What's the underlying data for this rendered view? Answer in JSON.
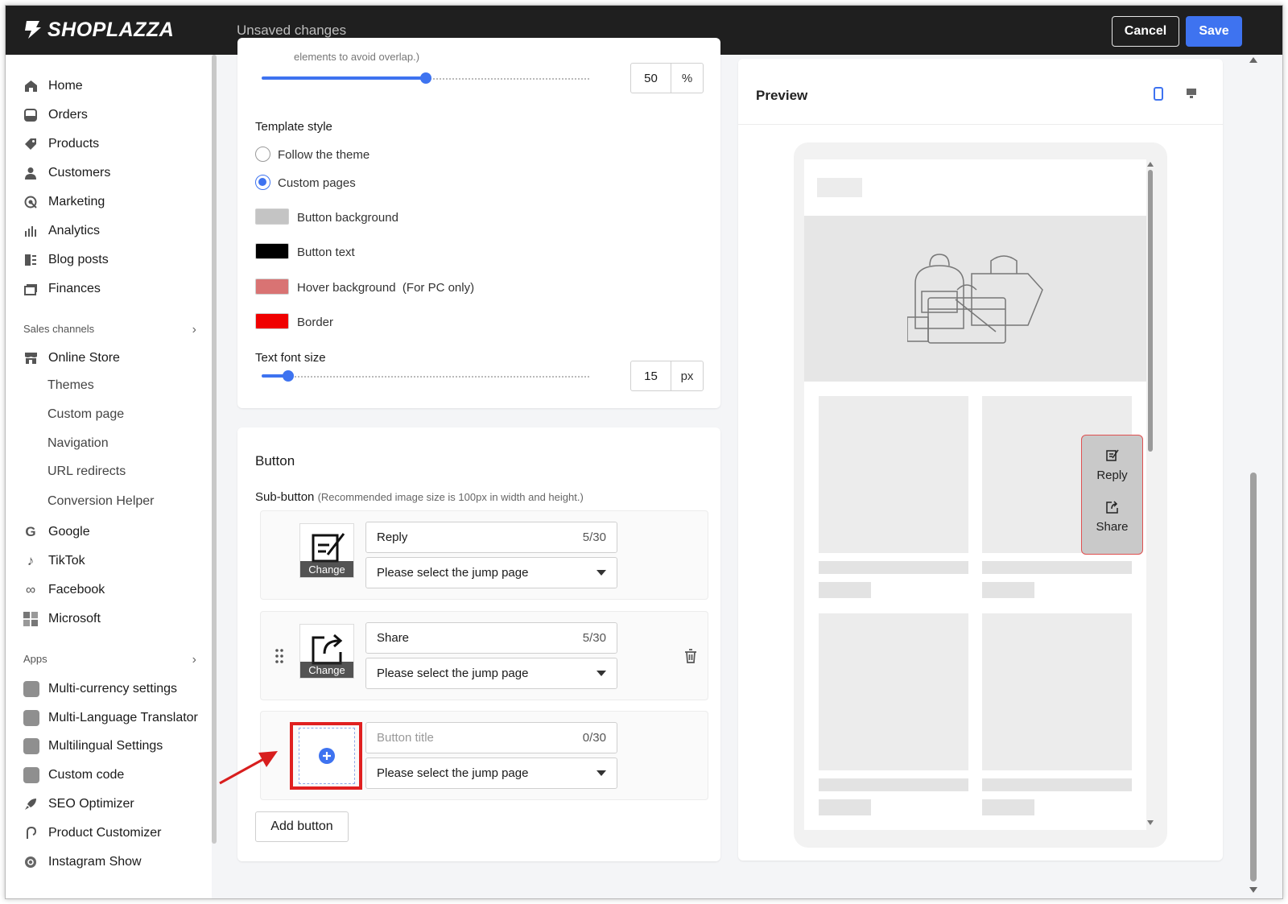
{
  "topbar": {
    "brand": "SHOPLAZZA",
    "status": "Unsaved changes",
    "cancel_label": "Cancel",
    "save_label": "Save"
  },
  "sidebar": {
    "main_items": [
      {
        "label": "Home",
        "icon": "home-icon"
      },
      {
        "label": "Orders",
        "icon": "orders-icon"
      },
      {
        "label": "Products",
        "icon": "tag-icon"
      },
      {
        "label": "Customers",
        "icon": "person-icon"
      },
      {
        "label": "Marketing",
        "icon": "target-icon"
      },
      {
        "label": "Analytics",
        "icon": "bar-chart-icon"
      },
      {
        "label": "Blog posts",
        "icon": "blog-icon"
      },
      {
        "label": "Finances",
        "icon": "finance-icon"
      }
    ],
    "sales_channels_label": "Sales channels",
    "online_store_label": "Online Store",
    "online_store_sub": [
      "Themes",
      "Custom page",
      "Navigation",
      "URL redirects",
      "Conversion Helper"
    ],
    "channels": [
      {
        "label": "Google",
        "icon": "google-icon"
      },
      {
        "label": "TikTok",
        "icon": "tiktok-icon"
      },
      {
        "label": "Facebook",
        "icon": "meta-icon"
      },
      {
        "label": "Microsoft",
        "icon": "microsoft-icon"
      }
    ],
    "apps_label": "Apps",
    "apps": [
      "Multi-currency settings",
      "Multi-Language Translator",
      "Multilingual Settings",
      "Custom code",
      "SEO Optimizer",
      "Product Customizer",
      "Instagram Show"
    ]
  },
  "settings": {
    "top_cut_text": "elements to avoid overlap.)",
    "offset_slider": {
      "value": "50",
      "unit": "%",
      "fraction": 0.5
    },
    "template_style_label": "Template style",
    "radio_follow": "Follow the theme",
    "radio_custom": "Custom pages",
    "selected_radio": "Custom pages",
    "colors": [
      {
        "label": "Button background",
        "color": "#c4c4c4"
      },
      {
        "label": "Button text",
        "color": "#000000"
      },
      {
        "label": "Hover background  (For PC only)",
        "color": "#d97373"
      },
      {
        "label": "Border",
        "color": "#f00000"
      }
    ],
    "font_size_label": "Text font size",
    "font_slider": {
      "value": "15",
      "unit": "px",
      "fraction": 0.08
    }
  },
  "button_section": {
    "title": "Button",
    "sub_label": "Sub-button",
    "sub_hint": "(Recommended image size is 100px in width and height.)",
    "change_label": "Change",
    "rows": [
      {
        "title": "Reply",
        "count": "5/30",
        "jump": "Please select the jump page",
        "icon": "reply-icon"
      },
      {
        "title": "Share",
        "count": "5/30",
        "jump": "Please select the jump page",
        "icon": "share-icon"
      }
    ],
    "new_row": {
      "placeholder": "Button title",
      "count": "0/30",
      "jump": "Please select the jump page"
    },
    "add_label": "Add button"
  },
  "preview": {
    "title": "Preview",
    "float_buttons": [
      {
        "label": "Reply",
        "icon": "reply-icon"
      },
      {
        "label": "Share",
        "icon": "share-icon"
      }
    ],
    "colors": {
      "accent": "#3e73f0",
      "highlight": "#e02020",
      "float_bg": "#c9c9c9",
      "float_border": "#e05050"
    }
  }
}
